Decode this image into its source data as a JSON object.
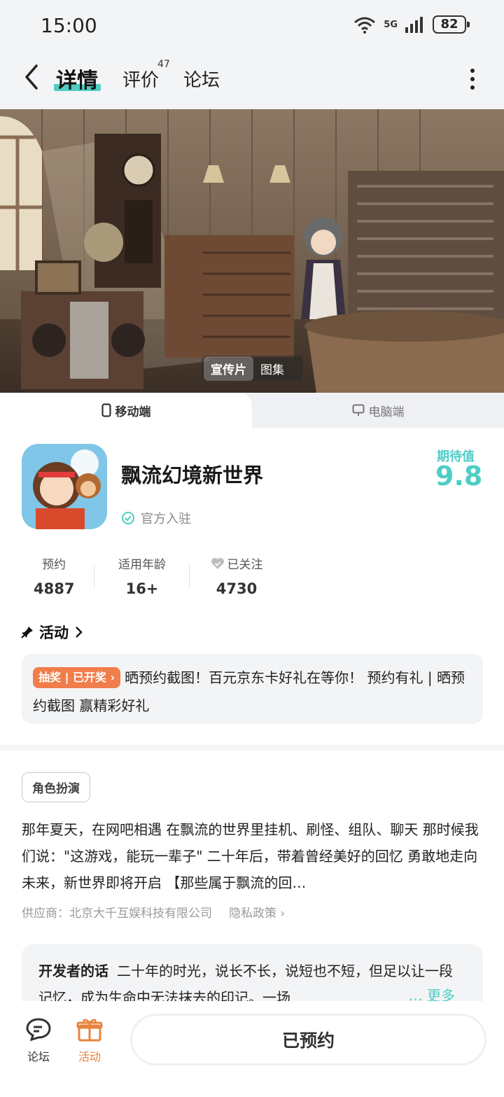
{
  "status_bar": {
    "time": "15:00",
    "network": "5G",
    "battery": "82"
  },
  "nav": {
    "tab_detail": "详情",
    "tab_review": "评价",
    "review_count": "47",
    "tab_forum": "论坛"
  },
  "banner": {
    "video_label": "宣传片",
    "gallery_label": "图集"
  },
  "platform": {
    "mobile": "移动端",
    "pc": "电脑端"
  },
  "game": {
    "title": "飘流幻境新世界",
    "official": "官方入驻",
    "expect_label": "期待值",
    "expect_value": "9.8"
  },
  "stats": [
    {
      "label": "预约",
      "value": "4887"
    },
    {
      "label": "适用年龄",
      "value": "16+"
    },
    {
      "label": "已关注",
      "value": "4730"
    }
  ],
  "activity": {
    "header": "活动",
    "badge": "抽奖 | 已开奖",
    "text": "晒预约截图！百元京东卡好礼在等你！ 预约有礼 | 晒预约截图 赢精彩好礼"
  },
  "description": {
    "tag": "角色扮演",
    "text": "那年夏天，在网吧相遇 在飘流的世界里挂机、刷怪、组队、聊天 那时候我们说：\"这游戏，能玩一辈子\" 二十年后，带着曾经美好的回忆 勇敢地走向未来，新世界即将开启 【那些属于飘流的回…",
    "supplier": "供应商：北京大千互娱科技有限公司",
    "privacy": "隐私政策"
  },
  "developer": {
    "title": "开发者的话",
    "text": "二十年的时光，说长不长，说短也不短，但足以让一段记忆，成为生命中无法抹去的印记。一场",
    "more": "更多"
  },
  "bottom": {
    "forum": "论坛",
    "activity": "活动",
    "reserved": "已预约"
  },
  "colors": {
    "accent": "#4ecdc4",
    "orange": "#f07d4a",
    "activity_icon": "#e8833e"
  }
}
